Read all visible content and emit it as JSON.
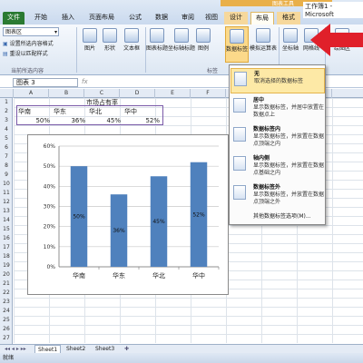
{
  "title_bar": {
    "contextual_group": "图表工具",
    "workbook_title": "工作簿1 - Microsoft"
  },
  "tabs": [
    "文件",
    "开始",
    "插入",
    "页面布局",
    "公式",
    "数据",
    "审阅",
    "视图",
    "设计",
    "布局",
    "格式"
  ],
  "ribbon": {
    "selector_value": "图表区",
    "format_selection": "设置所选内容格式",
    "reset_style": "重设以匹配样式",
    "group_current": "当前所选内容",
    "insert_buttons": [
      "图片",
      "形状",
      "文本框"
    ],
    "label_buttons": [
      "图表标题",
      "坐标轴标题",
      "图例",
      "数据标签",
      "模拟运算表"
    ],
    "axes_buttons": [
      "坐标轴",
      "网格线"
    ],
    "plot_area": "绘图区",
    "group_labels": "标签"
  },
  "formula_bar": {
    "name_box": "图表 3"
  },
  "columns": [
    "A",
    "B",
    "C",
    "D",
    "E",
    "F",
    "G",
    "H",
    "I"
  ],
  "rows": [
    "1",
    "2",
    "3",
    "4",
    "5",
    "6",
    "7",
    "8",
    "9",
    "10",
    "11",
    "12",
    "13",
    "14",
    "15",
    "16",
    "17",
    "18",
    "19",
    "20",
    "21",
    "22",
    "23",
    "24",
    "25",
    "26",
    "27"
  ],
  "sheet_cells": {
    "title": "市场占有率",
    "headers": [
      "华南",
      "华东",
      "华北",
      "华中"
    ],
    "values": [
      "50%",
      "36%",
      "45%",
      "52%"
    ]
  },
  "chart_data": {
    "type": "bar",
    "categories": [
      "华南",
      "华东",
      "华北",
      "华中"
    ],
    "values": [
      0.5,
      0.36,
      0.45,
      0.52
    ],
    "data_labels": [
      "50%",
      "36%",
      "45%",
      "52%"
    ],
    "y_ticks": [
      "0%",
      "10%",
      "20%",
      "30%",
      "40%",
      "50%",
      "60%"
    ],
    "ylim": [
      0,
      0.6
    ],
    "grid": true,
    "bar_color": "#4f81bd"
  },
  "dropdown": {
    "items": [
      {
        "title": "无",
        "desc": "取消选择的数据标签",
        "icon": "no-label-icon"
      },
      {
        "title": "居中",
        "desc": "显示数据标签，并居中放置在数据点上",
        "icon": "center-label-icon"
      },
      {
        "title": "数据标签内",
        "desc": "显示数据标签，并放置在数据点顶端之内",
        "icon": "inside-end-label-icon"
      },
      {
        "title": "轴内侧",
        "desc": "显示数据标签，并放置在数据点基础之内",
        "icon": "inside-base-label-icon"
      },
      {
        "title": "数据标签外",
        "desc": "显示数据标签，并放置在数据点顶端之外",
        "icon": "outside-end-label-icon"
      }
    ],
    "more": "其他数据标签选项(M)..."
  },
  "sheet_tabs": [
    "Sheet1",
    "Sheet2",
    "Sheet3"
  ],
  "status": "就绪",
  "colors": {
    "accent_green": "#2a7a32",
    "contextual": "#e9b04a",
    "arrow": "#e0202a"
  }
}
